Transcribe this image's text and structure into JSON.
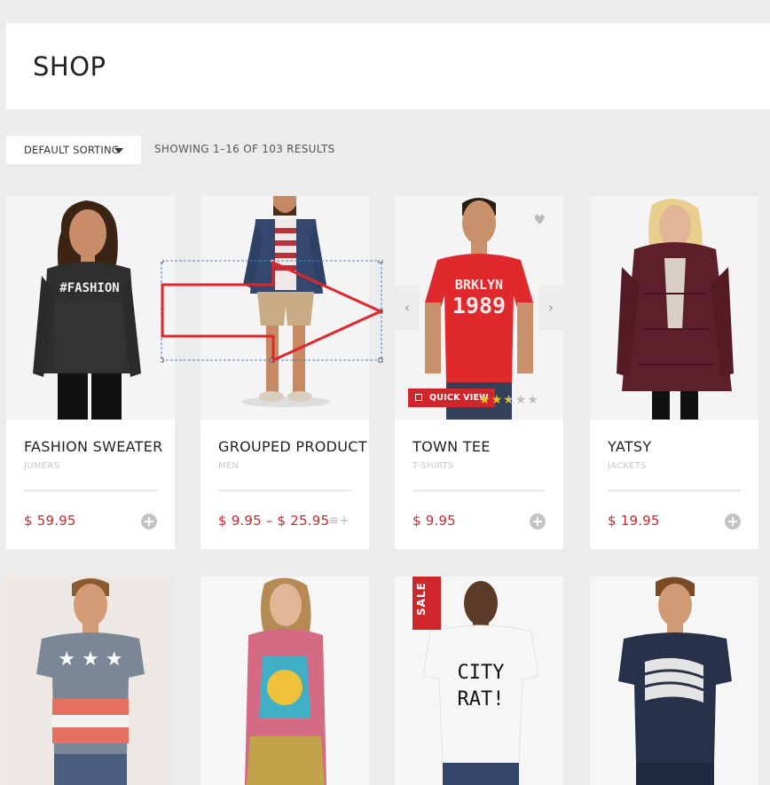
{
  "page": {
    "title": "SHOP"
  },
  "toolbar": {
    "sort_label": "DEFAULT SORTING",
    "results_text": "SHOWING 1–16 OF 103 RESULTS"
  },
  "products": [
    {
      "title": "FASHION SWEATER",
      "category": "JUMERS",
      "price": "$ 59.95"
    },
    {
      "title": "GROUPED PRODUCT",
      "category": "MEN",
      "price": "$ 9.95 – $ 25.95"
    },
    {
      "title": "TOWN TEE",
      "category": "T-SHIRTS",
      "price": "$ 9.95",
      "quick_view_label": "QUICK VIEW",
      "rating": 2.5,
      "rating_max": 5
    },
    {
      "title": "YATSY",
      "category": "JACKETS",
      "price": "$ 19.95"
    }
  ],
  "row2": [
    {
      "shirt_text": ""
    },
    {
      "shirt_text": ""
    },
    {
      "badge": "SALE",
      "shirt_text_top": "CITY",
      "shirt_text_bottom": "RAT!"
    },
    {
      "shirt_text": ""
    }
  ],
  "print_texts": {
    "sweater": "#FASHION",
    "tee_top": "BRKLYN",
    "tee_bottom": "1989"
  },
  "icons": {
    "add": "plus-circle-icon",
    "add_list": "list-add-icon",
    "wishlist": "heart-icon",
    "prev": "chevron-left-icon",
    "next": "chevron-right-icon"
  },
  "colors": {
    "accent": "#d0262b",
    "background": "#ececec",
    "star": "#f1c40f"
  }
}
